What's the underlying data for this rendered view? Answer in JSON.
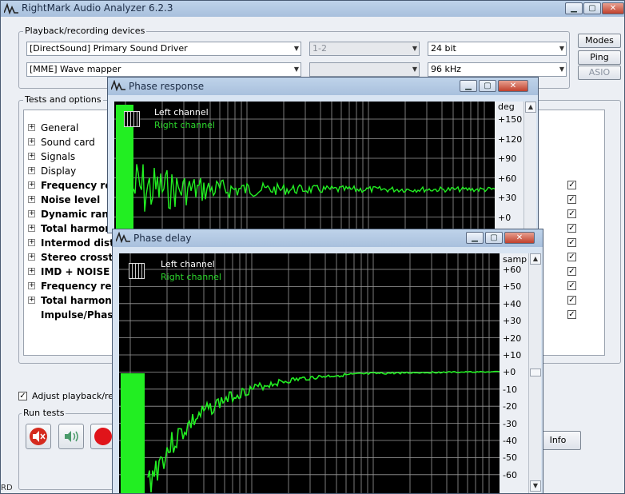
{
  "main_window": {
    "title": "RightMark Audio Analyzer 6.2.3",
    "devices_group": {
      "label": "Playback/recording devices",
      "playback_driver": "[DirectSound] Primary Sound Driver",
      "recording_driver": "[MME] Wave mapper",
      "channels": "1-2",
      "channels2": "",
      "bit_depth": "24 bit",
      "sample_rate": "96 kHz"
    },
    "side_buttons": {
      "modes": "Modes",
      "ping": "Ping",
      "asio": "ASIO"
    },
    "tests_group": {
      "label": "Tests and options",
      "items": [
        {
          "label": "General",
          "bold": false,
          "checked": null
        },
        {
          "label": "Sound card",
          "bold": false,
          "checked": null
        },
        {
          "label": "Signals",
          "bold": false,
          "checked": null
        },
        {
          "label": "Display",
          "bold": false,
          "checked": null
        },
        {
          "label": "Frequency res",
          "bold": true,
          "checked": true
        },
        {
          "label": "Noise level",
          "bold": true,
          "checked": true
        },
        {
          "label": "Dynamic rang",
          "bold": true,
          "checked": true
        },
        {
          "label": "Total harmon",
          "bold": true,
          "checked": true
        },
        {
          "label": "Intermod dist",
          "bold": true,
          "checked": true
        },
        {
          "label": "Stereo crosst",
          "bold": true,
          "checked": true
        },
        {
          "label": "IMD + NOISE",
          "bold": true,
          "checked": true
        },
        {
          "label": "Frequency res",
          "bold": true,
          "checked": true
        },
        {
          "label": "Total harmon",
          "bold": true,
          "checked": true
        },
        {
          "label": "Impulse/Phas",
          "bold": true,
          "checked": true
        }
      ]
    },
    "adjust_checkbox": {
      "label": "Adjust playback/re",
      "checked": true
    },
    "run_group": {
      "label": "Run tests"
    },
    "info_button": "Info",
    "status_fragment": "RD"
  },
  "phase_response": {
    "title": "Phase response",
    "legend": {
      "left": "Left channel",
      "right": "Right channel"
    },
    "unit": "deg",
    "y_ticks": [
      "+150",
      "+120",
      "+90",
      "+60",
      "+30",
      "+0"
    ],
    "colors": {
      "left": "#ffffff",
      "right": "#2cd62c",
      "trace": "#22ee22",
      "grid": "#b0b0b0"
    }
  },
  "phase_delay": {
    "title": "Phase delay",
    "legend": {
      "left": "Left channel",
      "right": "Right channel"
    },
    "unit": "samp",
    "y_ticks": [
      "+60",
      "+50",
      "+40",
      "+30",
      "+20",
      "+10",
      "+0",
      "-10",
      "-20",
      "-30",
      "-40",
      "-50",
      "-60"
    ]
  }
}
